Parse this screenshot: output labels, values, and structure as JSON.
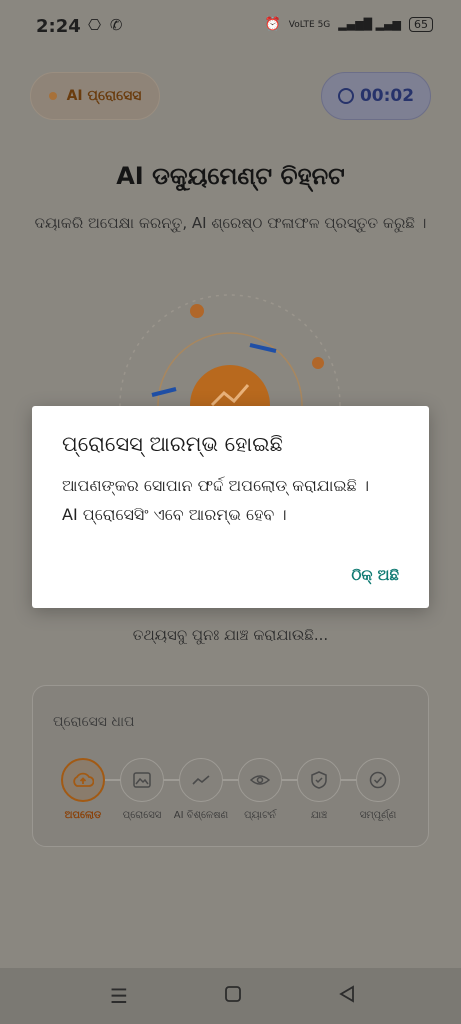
{
  "status": {
    "time": "2:24",
    "notifications": "⎔ ✆",
    "network": "VoLTE 5G",
    "signal": "▂▄▆█ ▂▄▆",
    "battery": "65"
  },
  "header": {
    "ai_pill_label": "AI ପ୍ରୋସେସ",
    "timer": "00:02"
  },
  "main": {
    "title": "AI ଡକ୍ୟୁମେଣ୍ଟ ଚିହ୍ନଟ",
    "subtitle": "ଦୟାକରି ଅପେକ୍ଷା କରନ୍ତୁ, AI ଶ୍ରେଷ୍ଠ ଫଳାଫଳ ପ୍ରସ୍ତୁତ କରୁଛି ।",
    "verifying": "ତଥ୍ୟସବୁ ପୁନଃ ଯାଞ୍ଚ କରାଯାଉଛି..."
  },
  "dialog": {
    "title": "ପ୍ରୋସେସ୍ ଆରମ୍ଭ ହୋଇଛି",
    "line1": "ଆପଣଙ୍କର ସୋପାନ ଫର୍ଦ୍ଦ ଅପଲୋଡ୍ କରାଯାଇଛି ।",
    "line2": "AI ପ୍ରୋସେସିଂ ଏବେ ଆରମ୍ଭ ହେବ ।",
    "ok_label": "ଠିକ୍ ଅଛି"
  },
  "steps": {
    "title": "ପ୍ରୋସେସ ଧାପ",
    "items": [
      {
        "label": "ଅପଲୋଡ",
        "icon": "cloud-upload-icon",
        "active": true
      },
      {
        "label": "ପ୍ରୋସେସ",
        "icon": "image-icon",
        "active": false
      },
      {
        "label": "AI ବିଶ୍ଳେଷଣ",
        "icon": "trend-icon",
        "active": false
      },
      {
        "label": "ପ୍ୟାଟର୍ନ",
        "icon": "eye-icon",
        "active": false
      },
      {
        "label": "ଯାଞ୍ଚ",
        "icon": "shield-check-icon",
        "active": false
      },
      {
        "label": "ସମ୍ପୂର୍ଣ୍ଣ",
        "icon": "check-circle-icon",
        "active": false
      }
    ]
  },
  "colors": {
    "accent": "#0f7a72",
    "active_step": "#a25a14",
    "orange": "#c67a1f",
    "blue": "#1f4fa6"
  }
}
